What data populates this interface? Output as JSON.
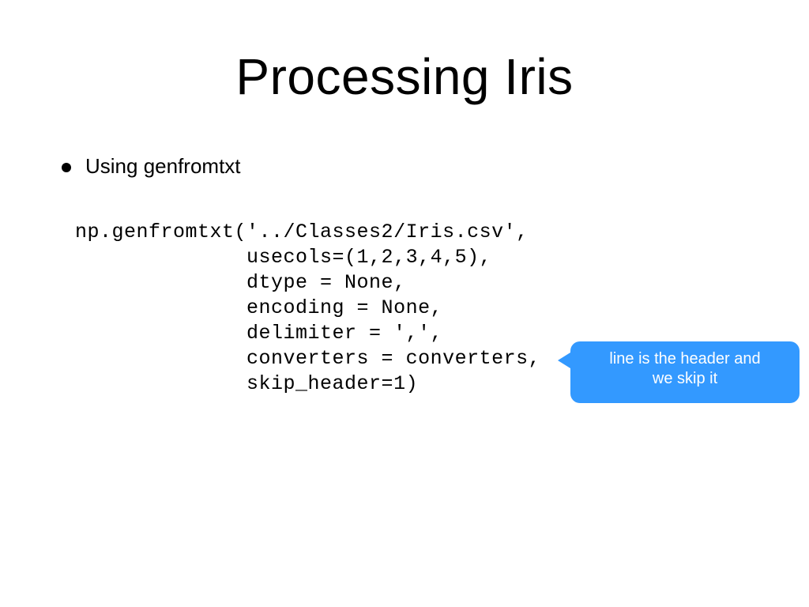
{
  "title": "Processing Iris",
  "bullet": "Using genfromtxt",
  "code": "np.genfromtxt('../Classes2/Iris.csv',\n              usecols=(1,2,3,4,5),\n              dtype = None,\n              encoding = None,\n              delimiter = ',',\n              converters = converters,\n              skip_header=1)",
  "callout": {
    "line1": "line is the header and",
    "line2": "we skip it"
  }
}
